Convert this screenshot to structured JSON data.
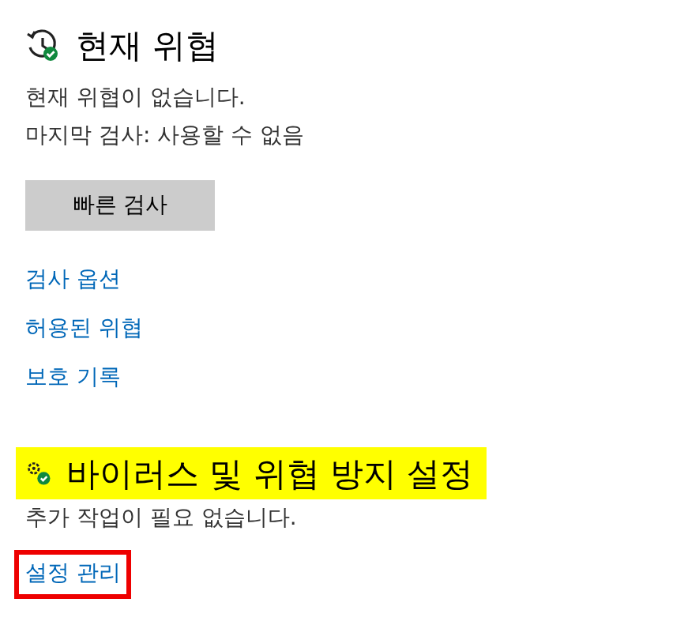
{
  "threats": {
    "title": "현재 위협",
    "status": "현재 위협이 없습니다.",
    "last_scan": "마지막 검사: 사용할 수 없음",
    "button": "빠른 검사",
    "links": [
      {
        "label": "검사 옵션",
        "outlined": false
      },
      {
        "label": "허용된 위협",
        "outlined": false
      },
      {
        "label": "보호 기록",
        "outlined": false
      }
    ]
  },
  "settings": {
    "title": "바이러스 및 위협 방지 설정",
    "highlighted": true,
    "status": "추가 작업이 필요 없습니다.",
    "links": [
      {
        "label": "설정 관리",
        "outlined": true
      }
    ]
  }
}
